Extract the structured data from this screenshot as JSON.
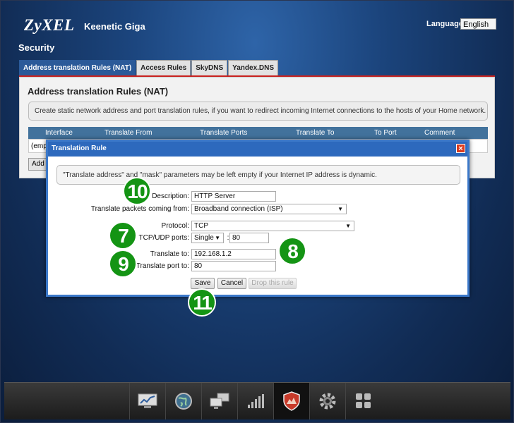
{
  "header": {
    "brand": "ZyXEL",
    "model": "Keenetic Giga",
    "language_label": "Language:",
    "language_value": "English"
  },
  "section_title": "Security",
  "tabs": [
    {
      "label": "Address translation Rules (NAT)",
      "active": true
    },
    {
      "label": "Access Rules",
      "active": false
    },
    {
      "label": "SkyDNS",
      "active": false
    },
    {
      "label": "Yandex.DNS",
      "active": false
    }
  ],
  "panel": {
    "title": "Address translation Rules (NAT)",
    "info": "Create static network address and port translation rules, if you want to redirect incoming Internet connections to the hosts of your Home network.",
    "columns": [
      "Interface",
      "Translate From",
      "Translate Ports",
      "Translate To",
      "To Port",
      "Comment"
    ],
    "empty_row": "(emp",
    "add_button": "Add"
  },
  "dialog": {
    "title": "Translation Rule",
    "info": "\"Translate address\" and \"mask\" parameters may be left empty if your Internet IP address is dynamic.",
    "description_label": "Description:",
    "description_value": "HTTP Server",
    "from_label": "Translate packets coming from:",
    "from_value": "Broadband connection (ISP)",
    "protocol_label": "Protocol:",
    "protocol_value": "TCP",
    "ports_label": "TCP/UDP ports:",
    "ports_mode": "Single",
    "ports_sep": ":",
    "ports_value": "80",
    "to_label": "Translate to:",
    "to_value": "192.168.1.2",
    "to_port_label": "Translate port to:",
    "to_port_value": "80",
    "save_label": "Save",
    "cancel_label": "Cancel",
    "drop_label": "Drop this rule"
  },
  "badges": {
    "b10": "10",
    "b7": "7",
    "b8": "8",
    "b9": "9",
    "b11": "11"
  },
  "bottom_nav": [
    {
      "icon": "monitor-chart-icon"
    },
    {
      "icon": "globe-icon"
    },
    {
      "icon": "network-computers-icon"
    },
    {
      "icon": "signal-bars-icon"
    },
    {
      "icon": "security-shield-icon",
      "active": true
    },
    {
      "icon": "gear-icon"
    },
    {
      "icon": "apps-grid-icon"
    }
  ],
  "colors": {
    "accent": "#2b5a99",
    "tab_line": "#c8211e",
    "badge": "#149414",
    "dialog_border": "#3b78c9"
  }
}
